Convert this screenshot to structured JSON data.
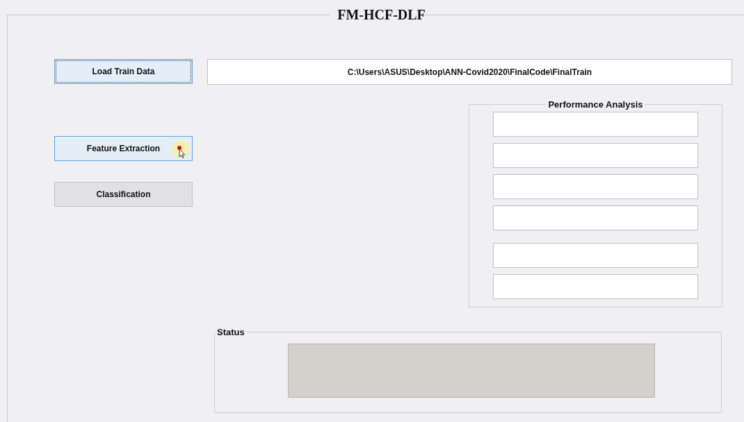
{
  "window": {
    "title": "FM-HCF-DLF"
  },
  "buttons": [
    {
      "label": "Load Train Data",
      "focused": true,
      "hovered": false
    },
    {
      "label": "Feature Extraction",
      "focused": false,
      "hovered": true
    },
    {
      "label": "Classification",
      "focused": false,
      "hovered": false
    }
  ],
  "path_field": {
    "value": "C:\\Users\\ASUS\\Desktop\\ANN-Covid2020\\FinalCode\\FinalTrain"
  },
  "performance_analysis": {
    "title": "Performance Analysis",
    "groups": [
      {
        "fields": [
          {
            "kind": "output"
          },
          {
            "kind": "output"
          },
          {
            "kind": "output"
          },
          {
            "kind": "output"
          }
        ]
      },
      {
        "fields": [
          {
            "kind": "output"
          },
          {
            "kind": "output"
          }
        ]
      }
    ]
  },
  "status": {
    "title": "Status",
    "display": {
      "kind": "indicator"
    }
  }
}
